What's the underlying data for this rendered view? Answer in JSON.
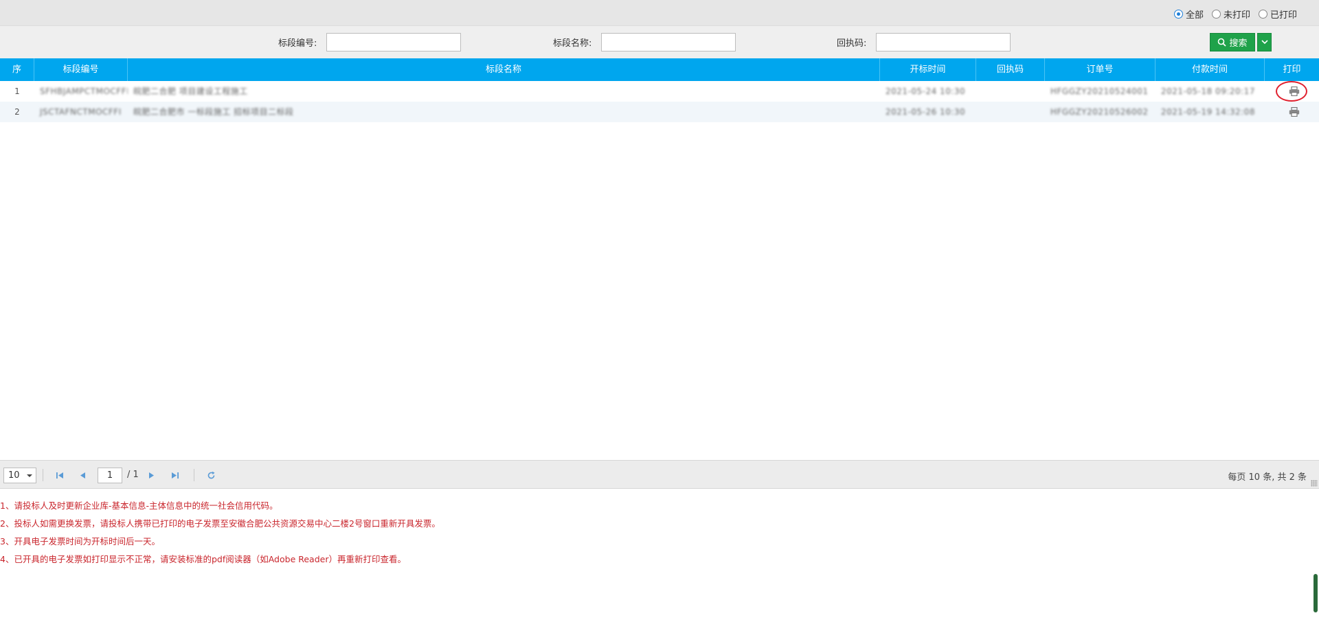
{
  "filter": {
    "options": [
      {
        "label": "全部",
        "checked": true
      },
      {
        "label": "未打印",
        "checked": false
      },
      {
        "label": "已打印",
        "checked": false
      }
    ]
  },
  "search": {
    "field1_label": "标段编号:",
    "field1_value": "",
    "field2_label": "标段名称:",
    "field2_value": "",
    "field3_label": "回执码:",
    "field3_value": "",
    "button_label": "搜索"
  },
  "table": {
    "columns": [
      "序",
      "标段编号",
      "标段名称",
      "开标时间",
      "回执码",
      "订单号",
      "付款时间",
      "打印"
    ],
    "rows": [
      {
        "index": "1",
        "code": "SFHBJAMPCTMOCFFI",
        "name": "皖肥二合肥 项目建设工程施工",
        "open_time": "2021-05-24 10:30",
        "receipt": "",
        "order": "HFGGZY20210524001",
        "pay_time": "2021-05-18 09:20:17"
      },
      {
        "index": "2",
        "code": "JSCTAFNCTMOCFFI",
        "name": "皖肥二合肥市 一标段施工 招标项目二标段",
        "open_time": "2021-05-26 10:30",
        "receipt": "",
        "order": "HFGGZY20210526002",
        "pay_time": "2021-05-19 14:32:08"
      }
    ]
  },
  "pager": {
    "page_size": "10",
    "current_page": "1",
    "total_pages": "/ 1",
    "info": "每页 10 条, 共 2 条"
  },
  "notes": [
    "1、请投标人及时更新企业库-基本信息-主体信息中的统一社会信用代码。",
    "2、投标人如需更换发票，请投标人携带已打印的电子发票至安徽合肥公共资源交易中心二楼2号窗口重新开具发票。",
    "3、开具电子发票时间为开标时间后一天。",
    "4、已开具的电子发票如打印显示不正常，请安装标准的pdf阅读器（如Adobe Reader）再重新打印查看。"
  ],
  "colors": {
    "header_bg": "#00a6ee",
    "search_button": "#1fa24a",
    "note_text": "#c9252c",
    "highlight_ring": "#e0202e"
  },
  "icons": {
    "search": "search-icon",
    "dropdown": "chevron-down-icon",
    "print": "printer-icon",
    "first": "first-page-icon",
    "prev": "prev-page-icon",
    "next": "next-page-icon",
    "last": "last-page-icon",
    "refresh": "refresh-icon"
  }
}
